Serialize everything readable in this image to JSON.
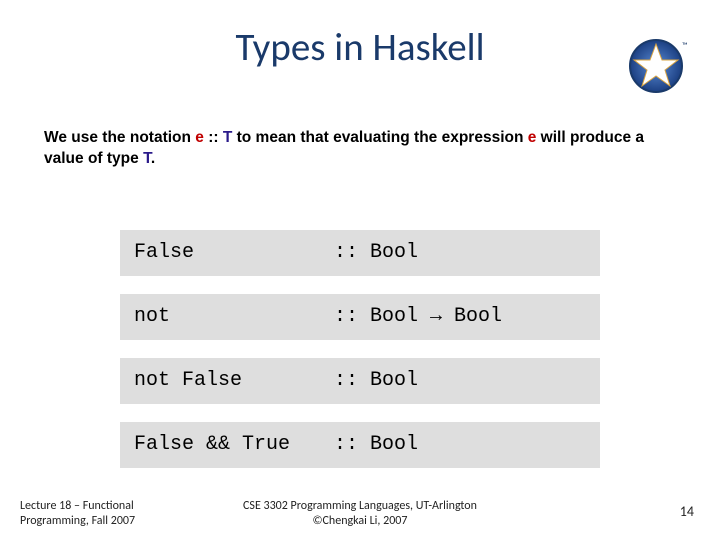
{
  "title": "Types in Haskell",
  "intro": {
    "p1": "We use the notation ",
    "e1": "e",
    "sep1": " :: ",
    "T1": "T",
    "p2": " to mean that evaluating the expression ",
    "e2": "e",
    "p3": " will produce a value of type ",
    "T2": "T",
    "p4": "."
  },
  "rows": [
    {
      "lhs": "False",
      "rhs": ":: Bool"
    },
    {
      "lhs": "not",
      "rhs": ":: Bool → Bool"
    },
    {
      "lhs": "not False",
      "rhs": ":: Bool"
    },
    {
      "lhs": "False && True",
      "rhs": ":: Bool"
    }
  ],
  "footer": {
    "left_l1": "Lecture 18 – Functional",
    "left_l2": "Programming, Fall 2007",
    "center_l1": "CSE 3302 Programming Languages, UT-Arlington",
    "center_l2": "©Chengkai Li, 2007",
    "page": "14"
  }
}
